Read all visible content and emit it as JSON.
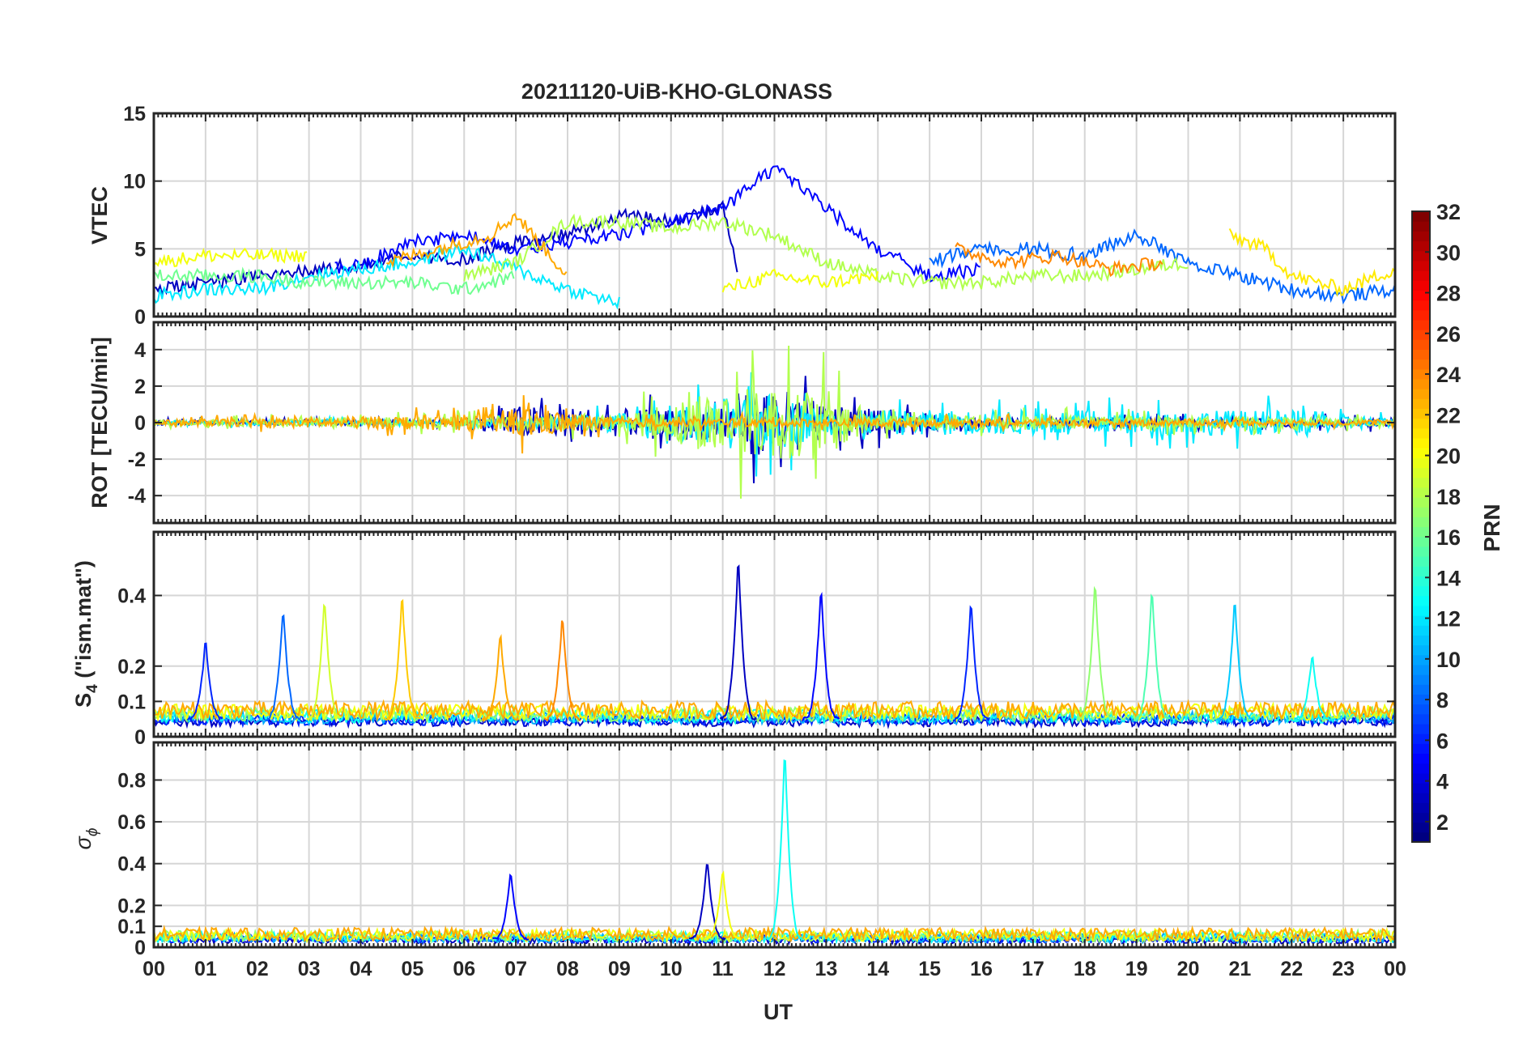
{
  "figure": {
    "title": "20211120-UiB-KHO-GLONASS",
    "xlabel": "UT",
    "x_tick_labels": [
      "00",
      "01",
      "02",
      "03",
      "04",
      "05",
      "06",
      "07",
      "08",
      "09",
      "10",
      "11",
      "12",
      "13",
      "14",
      "15",
      "16",
      "17",
      "18",
      "19",
      "20",
      "21",
      "22",
      "23",
      "00"
    ]
  },
  "colorbar": {
    "label": "PRN",
    "range": [
      1,
      32
    ],
    "tick_labels": [
      "2",
      "4",
      "6",
      "8",
      "10",
      "12",
      "14",
      "16",
      "18",
      "20",
      "22",
      "24",
      "26",
      "28",
      "30",
      "32"
    ],
    "colormap": "jet"
  },
  "panel_labels": {
    "vtec": "VTEC",
    "rot": "ROT [TECU/min]",
    "s4_main": "S",
    "s4_sub": "4",
    "s4_rest": " (\"ism.mat\")",
    "sigma_main": "σ",
    "sigma_sub": "ϕ"
  },
  "chart_data": [
    {
      "type": "line",
      "panel": "vtec",
      "ylabel": "VTEC",
      "xlim": [
        0,
        24
      ],
      "ylim": [
        0,
        15
      ],
      "y_tick_labels": [
        "0",
        "5",
        "10",
        "15"
      ],
      "grid": true,
      "series_summary": [
        {
          "prn": 3,
          "x": [
            0,
            1,
            2,
            3,
            4,
            5,
            6,
            7,
            8,
            9,
            10,
            11,
            11.3
          ],
          "y": [
            2,
            2.5,
            3,
            3.5,
            3.8,
            4.5,
            4.2,
            5.5,
            6,
            7.5,
            7,
            8,
            3
          ]
        },
        {
          "prn": 5,
          "x": [
            3.5,
            4,
            5,
            6,
            7,
            8,
            9,
            10,
            11,
            12,
            13,
            14,
            15,
            16
          ],
          "y": [
            3.5,
            3.8,
            5.5,
            6,
            5,
            5.5,
            6,
            7,
            8,
            11,
            8,
            5,
            3,
            3.5
          ]
        },
        {
          "prn": 8,
          "x": [
            15,
            16,
            17,
            18,
            19,
            20,
            21,
            22,
            23,
            24
          ],
          "y": [
            4,
            5,
            5,
            4.5,
            6,
            4,
            3,
            2,
            1.5,
            2
          ]
        },
        {
          "prn": 12,
          "x": [
            0,
            1,
            2,
            3,
            4,
            5,
            6,
            7,
            8,
            9
          ],
          "y": [
            1.5,
            2,
            2,
            3,
            3.5,
            4,
            5,
            3.5,
            2,
            1
          ]
        },
        {
          "prn": 16,
          "x": [
            0,
            1,
            2,
            3,
            4,
            5,
            6,
            7
          ],
          "y": [
            3,
            3,
            3,
            2.5,
            2.5,
            2.5,
            2,
            3
          ]
        },
        {
          "prn": 18,
          "x": [
            6,
            7,
            8,
            9,
            10,
            11,
            12,
            13,
            14,
            15,
            16,
            17,
            18,
            19,
            20
          ],
          "y": [
            3,
            4,
            7,
            7,
            6.5,
            7,
            6,
            4,
            3,
            2.5,
            2.5,
            3,
            3,
            3.5,
            4
          ]
        },
        {
          "prn": 20,
          "x": [
            0,
            1,
            2,
            3
          ],
          "y": [
            4,
            4.5,
            4.5,
            4.5
          ]
        },
        {
          "prn": 20,
          "x": [
            11,
            12,
            13,
            14
          ],
          "y": [
            2,
            3,
            2.5,
            3
          ]
        },
        {
          "prn": 21,
          "x": [
            20.8,
            21.5,
            22,
            23,
            24
          ],
          "y": [
            6,
            5,
            3,
            2,
            3.5
          ]
        },
        {
          "prn": 23,
          "x": [
            4.5,
            5.5,
            6.5,
            7,
            8
          ],
          "y": [
            4,
            5,
            6,
            7.5,
            3
          ]
        },
        {
          "prn": 24,
          "x": [
            15.5,
            16.5,
            17.5,
            18.5,
            19.5
          ],
          "y": [
            5,
            4,
            4.5,
            3.5,
            4
          ]
        }
      ]
    },
    {
      "type": "line",
      "panel": "rot",
      "ylabel": "ROT [TECU/min]",
      "xlim": [
        0,
        24
      ],
      "ylim": [
        -5.5,
        5.5
      ],
      "y_tick_labels": [
        "-4",
        "-2",
        "0",
        "2",
        "4"
      ],
      "grid": true,
      "series_summary": [
        {
          "prn": 3,
          "x": [
            0,
            6,
            7,
            10,
            11,
            12,
            13,
            16,
            24
          ],
          "amplitude": [
            0.3,
            0.3,
            2,
            1.5,
            2.5,
            4.5,
            2,
            0.5,
            0.5
          ]
        },
        {
          "prn": 12,
          "x": [
            0,
            6,
            10,
            11,
            12,
            13,
            22,
            24
          ],
          "amplitude": [
            0.3,
            0.3,
            1.5,
            3,
            3.5,
            1.5,
            1.5,
            0.5
          ]
        },
        {
          "prn": 18,
          "x": [
            0,
            9,
            10,
            11,
            12,
            13,
            14,
            24
          ],
          "amplitude": [
            0.3,
            1,
            2.5,
            4,
            4.5,
            4,
            1,
            0.5
          ]
        },
        {
          "prn": 23,
          "x": [
            0,
            6.5,
            7,
            9,
            15,
            24
          ],
          "amplitude": [
            0.3,
            1,
            2,
            0.5,
            0.5,
            0.3
          ]
        }
      ]
    },
    {
      "type": "line",
      "panel": "s4",
      "ylabel": "S4 (\"ism.mat\")",
      "xlim": [
        0,
        24
      ],
      "ylim": [
        0,
        0.58
      ],
      "y_tick_labels": [
        "0",
        "0.1",
        "0.2",
        "0.4"
      ],
      "grid": true,
      "peaks": [
        {
          "prn": 6,
          "x": 1.0,
          "y": 0.28
        },
        {
          "prn": 8,
          "x": 2.5,
          "y": 0.37
        },
        {
          "prn": 19,
          "x": 3.3,
          "y": 0.4
        },
        {
          "prn": 22,
          "x": 4.8,
          "y": 0.41
        },
        {
          "prn": 23,
          "x": 6.7,
          "y": 0.3
        },
        {
          "prn": 24,
          "x": 7.9,
          "y": 0.35
        },
        {
          "prn": 3,
          "x": 11.3,
          "y": 0.52
        },
        {
          "prn": 5,
          "x": 12.9,
          "y": 0.43
        },
        {
          "prn": 6,
          "x": 15.8,
          "y": 0.39
        },
        {
          "prn": 17,
          "x": 18.2,
          "y": 0.45
        },
        {
          "prn": 15,
          "x": 19.3,
          "y": 0.43
        },
        {
          "prn": 11,
          "x": 20.9,
          "y": 0.4
        },
        {
          "prn": 13,
          "x": 22.4,
          "y": 0.24
        }
      ],
      "baseline": 0.05
    },
    {
      "type": "line",
      "panel": "sigma_phi",
      "ylabel": "σϕ",
      "xlim": [
        0,
        24
      ],
      "ylim": [
        0,
        0.98
      ],
      "y_tick_labels": [
        "0",
        "0.1",
        "0.2",
        "0.4",
        "0.6",
        "0.8"
      ],
      "grid": true,
      "peaks": [
        {
          "prn": 5,
          "x": 6.9,
          "y": 0.37
        },
        {
          "prn": 3,
          "x": 10.7,
          "y": 0.43
        },
        {
          "prn": 20,
          "x": 11.0,
          "y": 0.38
        },
        {
          "prn": 13,
          "x": 12.2,
          "y": 0.97
        }
      ],
      "baseline": 0.04
    }
  ]
}
